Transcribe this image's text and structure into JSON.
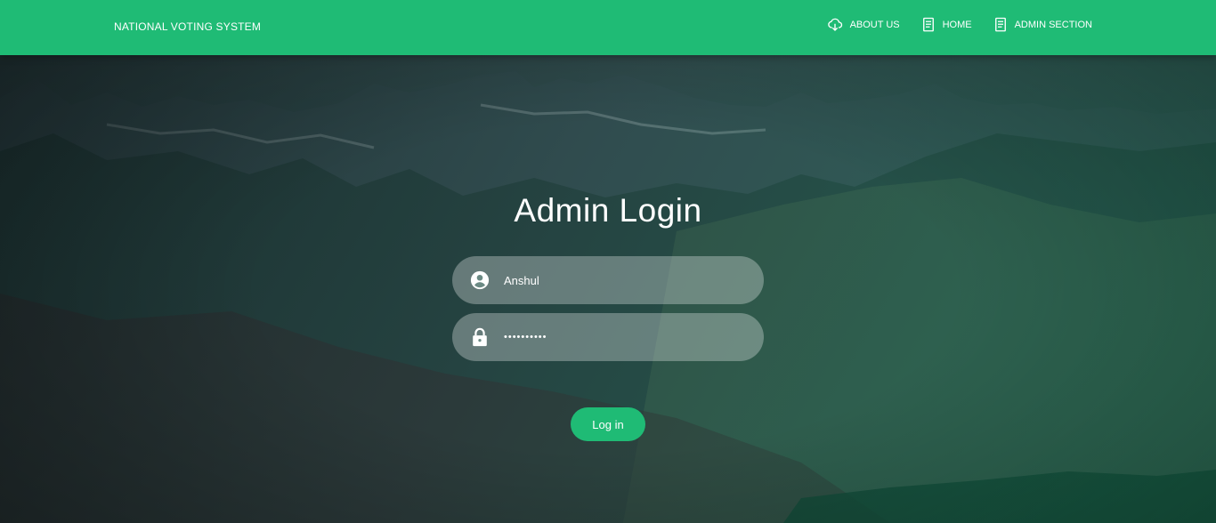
{
  "brand": "NATIONAL VOTING SYSTEM",
  "nav": {
    "items": [
      {
        "label": "ABOUT US",
        "icon": "cloud-download-icon"
      },
      {
        "label": "HOME",
        "icon": "document-icon"
      },
      {
        "label": "ADMIN SECTION",
        "icon": "document-icon"
      }
    ]
  },
  "form": {
    "title": "Admin Login",
    "username": {
      "value": "Anshul",
      "icon": "account-circle-icon"
    },
    "password": {
      "value": "••••••••••",
      "icon": "lock-icon"
    },
    "submit_label": "Log in"
  },
  "colors": {
    "accent": "#1fbb75",
    "text": "#ffffff"
  }
}
